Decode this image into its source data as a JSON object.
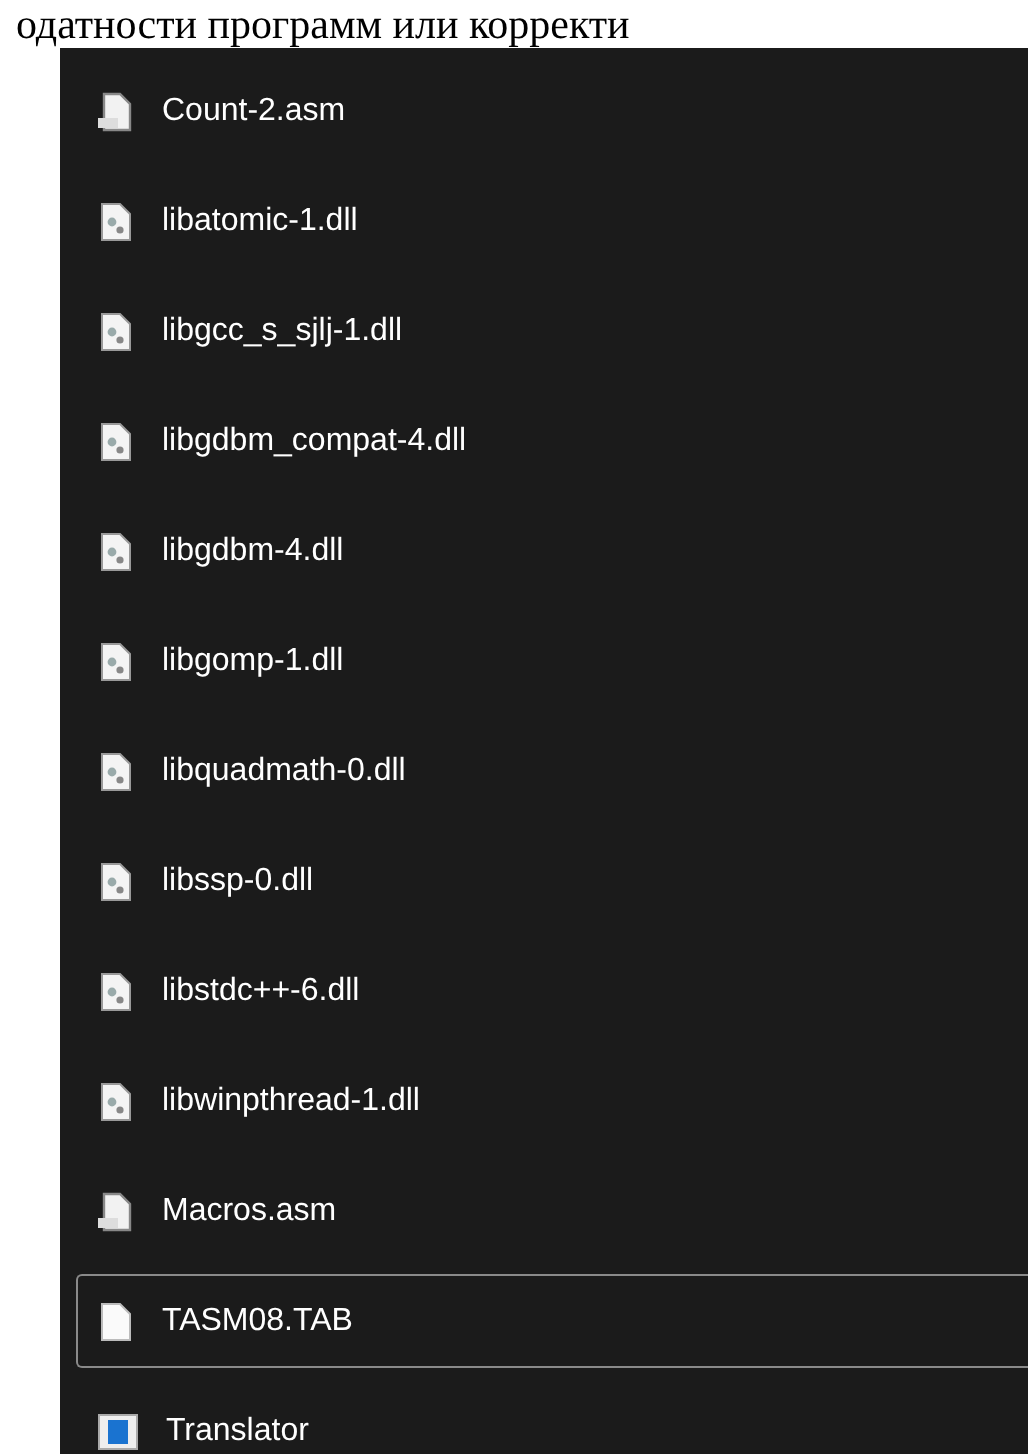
{
  "document_text": "одатности программ или корректи",
  "files": [
    {
      "name": "Count-2.asm",
      "kind": "asm",
      "selected": false
    },
    {
      "name": "libatomic-1.dll",
      "kind": "dll",
      "selected": false
    },
    {
      "name": "libgcc_s_sjlj-1.dll",
      "kind": "dll",
      "selected": false
    },
    {
      "name": "libgdbm_compat-4.dll",
      "kind": "dll",
      "selected": false
    },
    {
      "name": "libgdbm-4.dll",
      "kind": "dll",
      "selected": false
    },
    {
      "name": "libgomp-1.dll",
      "kind": "dll",
      "selected": false
    },
    {
      "name": "libquadmath-0.dll",
      "kind": "dll",
      "selected": false
    },
    {
      "name": "libssp-0.dll",
      "kind": "dll",
      "selected": false
    },
    {
      "name": "libstdc++-6.dll",
      "kind": "dll",
      "selected": false
    },
    {
      "name": "libwinpthread-1.dll",
      "kind": "dll",
      "selected": false
    },
    {
      "name": "Macros.asm",
      "kind": "asm",
      "selected": false
    },
    {
      "name": "TASM08.TAB",
      "kind": "file",
      "selected": true
    },
    {
      "name": "Translator",
      "kind": "exe",
      "selected": false
    }
  ]
}
